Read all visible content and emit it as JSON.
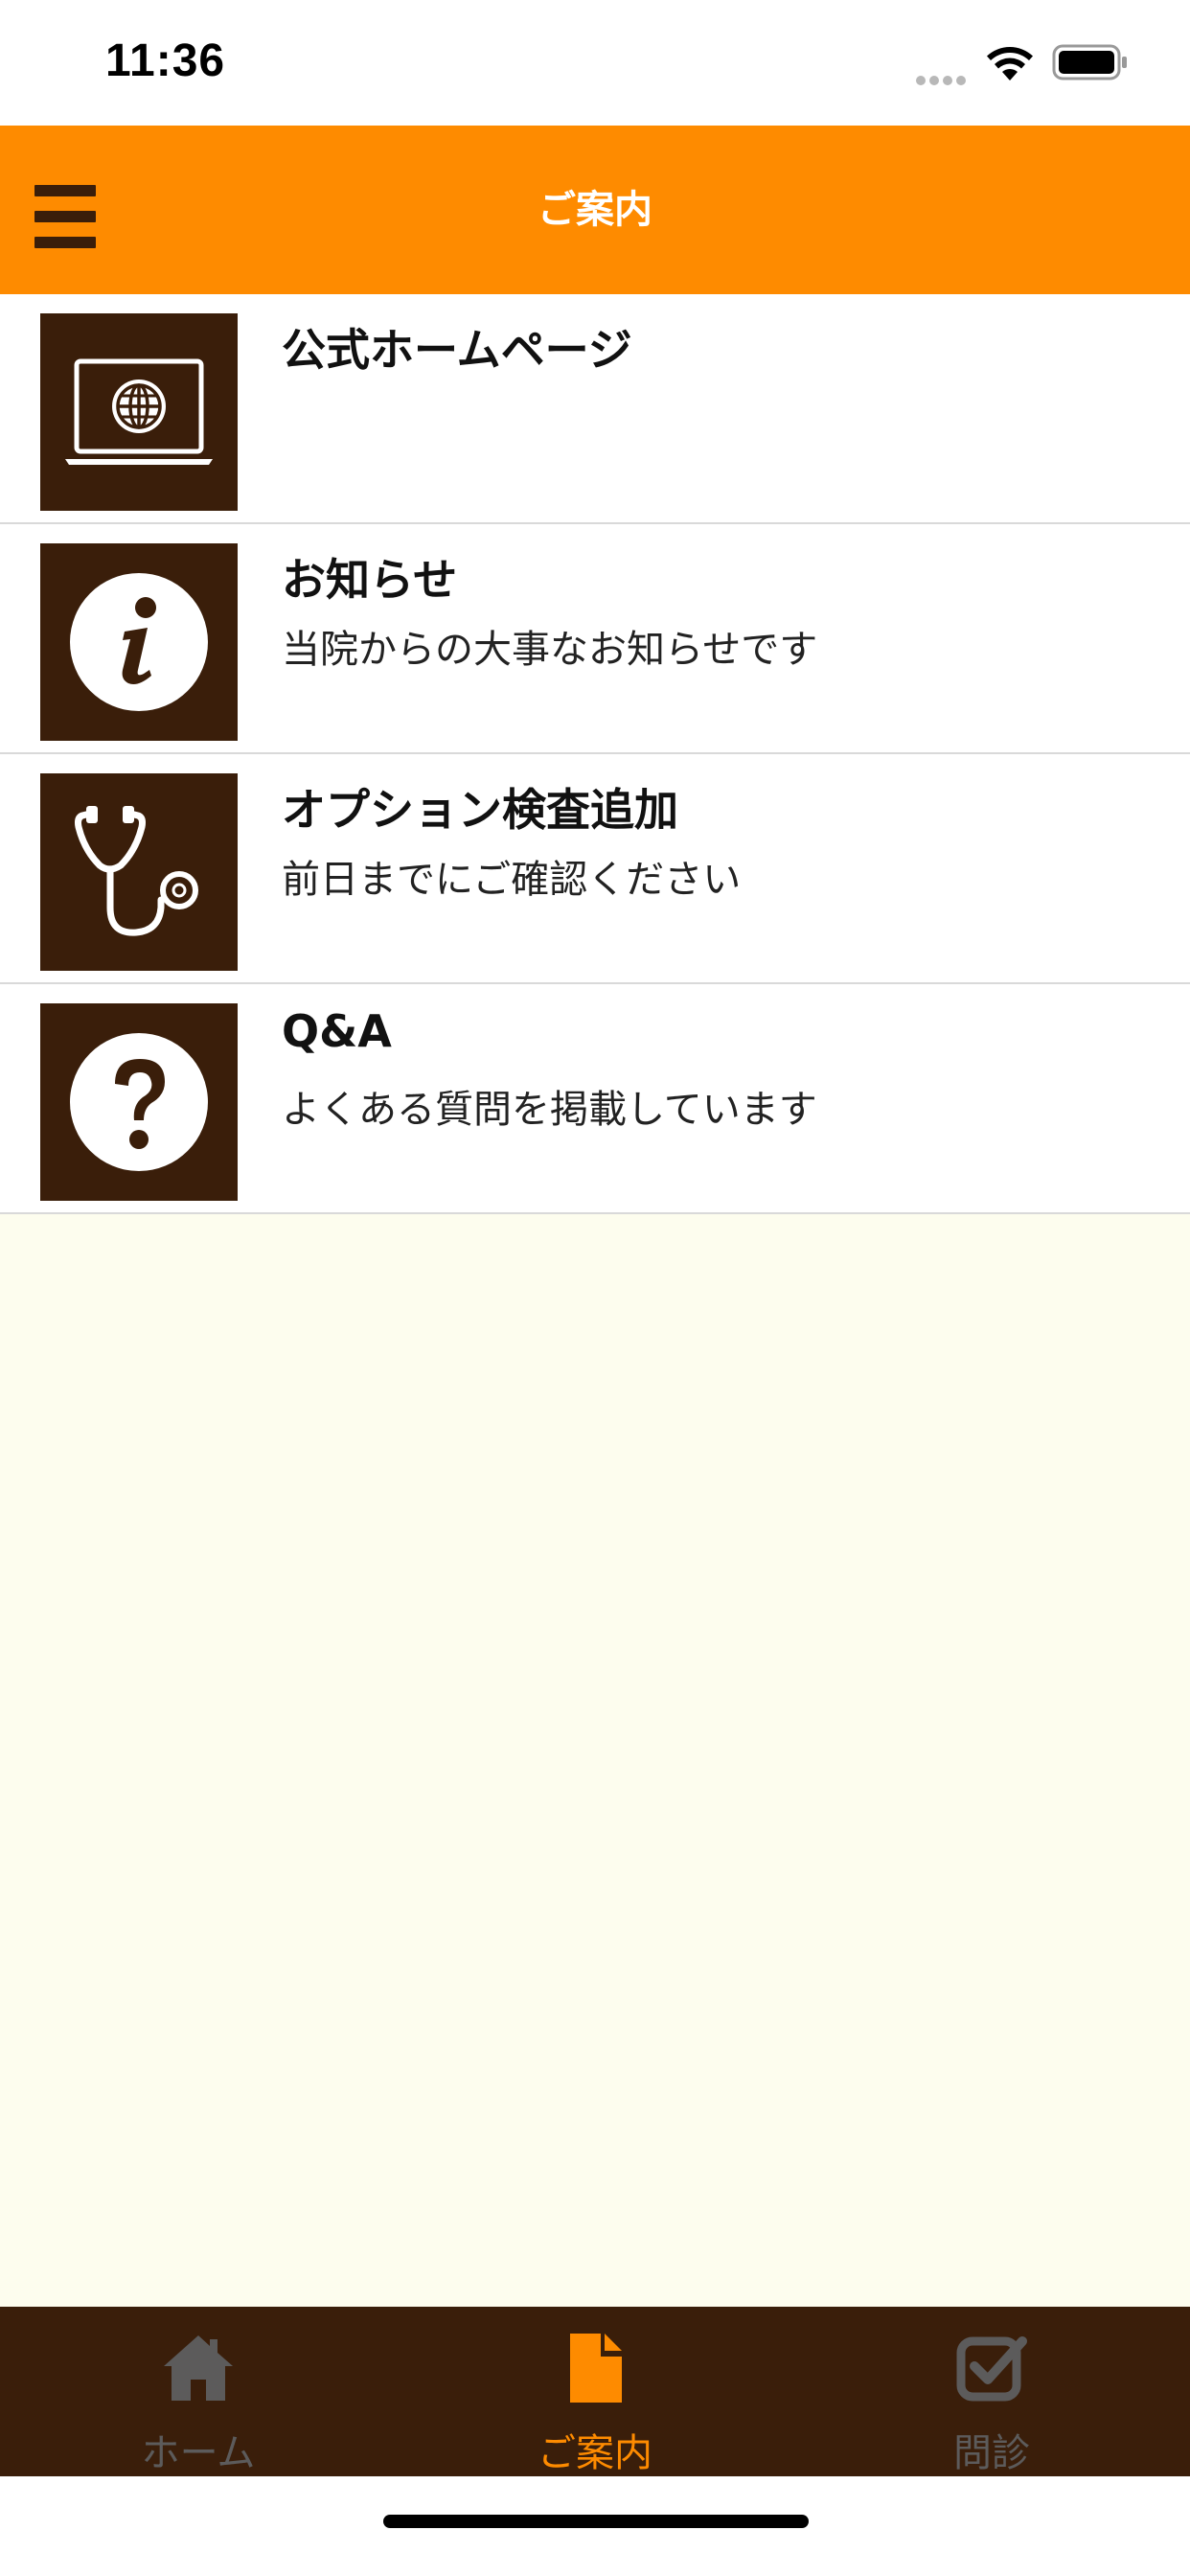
{
  "status_bar": {
    "time": "11:36"
  },
  "header": {
    "title": "ご案内"
  },
  "items": [
    {
      "title": "公式ホームページ",
      "subtitle": "",
      "icon": "laptop-globe-icon"
    },
    {
      "title": "お知らせ",
      "subtitle": "当院からの大事なお知らせです",
      "icon": "info-icon"
    },
    {
      "title": "オプション検査追加",
      "subtitle": "前日までにご確認ください",
      "icon": "stethoscope-icon"
    },
    {
      "title": "Q&A",
      "subtitle": "よくある質問を掲載しています",
      "icon": "question-icon"
    }
  ],
  "tab_bar": {
    "tabs": [
      {
        "label": "ホーム",
        "icon": "home-icon",
        "active": false
      },
      {
        "label": "ご案内",
        "icon": "document-icon",
        "active": true
      },
      {
        "label": "問診",
        "icon": "checkbox-icon",
        "active": false
      }
    ]
  },
  "colors": {
    "accent": "#fe8b00",
    "dark_brown": "#3a1e0a",
    "background": "#fdfdee",
    "inactive_tab": "#5c5b5b"
  }
}
